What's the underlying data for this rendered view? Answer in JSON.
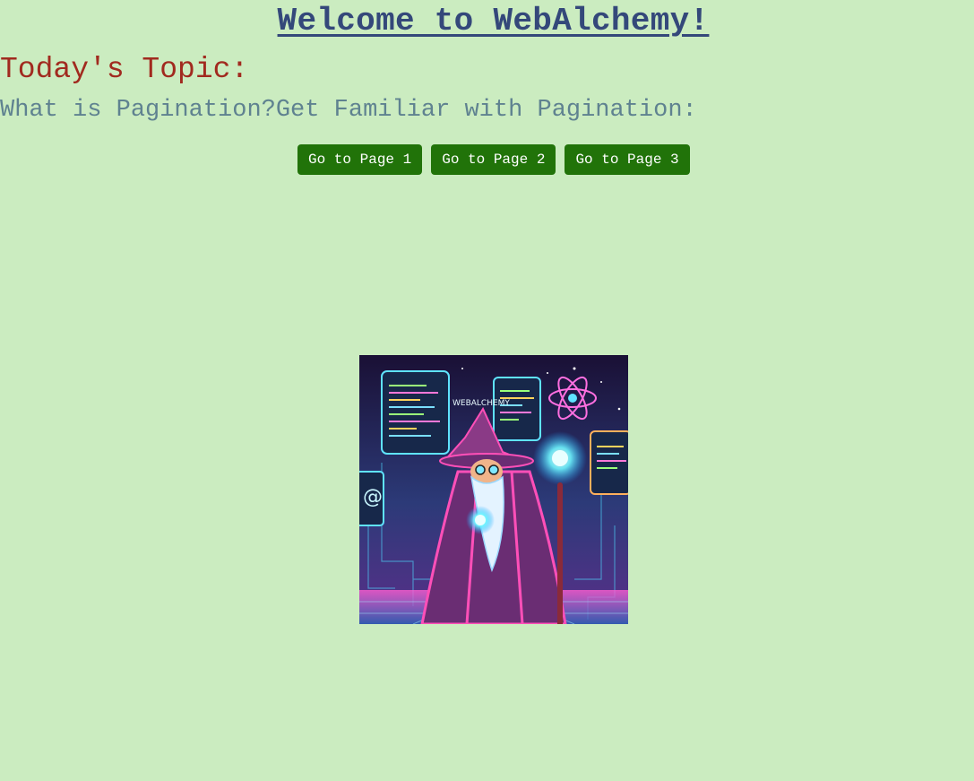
{
  "header": {
    "title": "Welcome to WebAlchemy!"
  },
  "topic": {
    "heading": "Today's Topic:",
    "subheading": "What is Pagination?Get Familiar with Pagination:"
  },
  "pagination": {
    "buttons": [
      {
        "label": "Go to Page 1"
      },
      {
        "label": "Go to Page 2"
      },
      {
        "label": "Go to Page 3"
      }
    ]
  },
  "hero_image": {
    "sign_text": "WEBALCHEMY",
    "subject": "wizard-illustration"
  },
  "colors": {
    "background": "#cbecc0",
    "title": "#34487a",
    "topic_heading": "#a12a1f",
    "topic_line": "#5f8290",
    "button": "#217309",
    "button_text": "#ffffff"
  }
}
